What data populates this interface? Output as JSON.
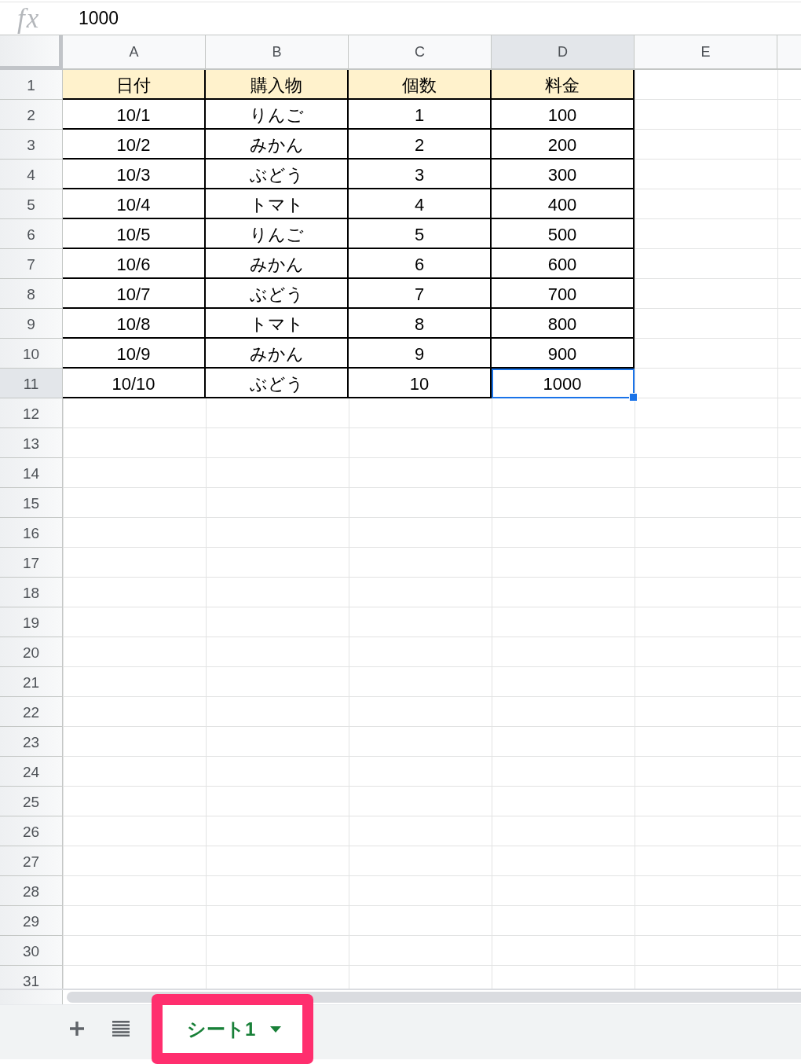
{
  "formula_bar": {
    "label": "fx",
    "value": "1000"
  },
  "columns": [
    {
      "label": "A",
      "selected": false
    },
    {
      "label": "B",
      "selected": false
    },
    {
      "label": "C",
      "selected": false
    },
    {
      "label": "D",
      "selected": true
    },
    {
      "label": "E",
      "selected": false
    }
  ],
  "rows": [
    {
      "label": "1",
      "kind": "header",
      "selected": false,
      "cells": [
        "日付",
        "購入物",
        "個数",
        "料金"
      ]
    },
    {
      "label": "2",
      "kind": "data",
      "selected": false,
      "cells": [
        "10/1",
        "りんご",
        "1",
        "100"
      ]
    },
    {
      "label": "3",
      "kind": "data",
      "selected": false,
      "cells": [
        "10/2",
        "みかん",
        "2",
        "200"
      ]
    },
    {
      "label": "4",
      "kind": "data",
      "selected": false,
      "cells": [
        "10/3",
        "ぶどう",
        "3",
        "300"
      ]
    },
    {
      "label": "5",
      "kind": "data",
      "selected": false,
      "cells": [
        "10/4",
        "トマト",
        "4",
        "400"
      ]
    },
    {
      "label": "6",
      "kind": "data",
      "selected": false,
      "cells": [
        "10/5",
        "りんご",
        "5",
        "500"
      ]
    },
    {
      "label": "7",
      "kind": "data",
      "selected": false,
      "cells": [
        "10/6",
        "みかん",
        "6",
        "600"
      ]
    },
    {
      "label": "8",
      "kind": "data",
      "selected": false,
      "cells": [
        "10/7",
        "ぶどう",
        "7",
        "700"
      ]
    },
    {
      "label": "9",
      "kind": "data",
      "selected": false,
      "cells": [
        "10/8",
        "トマト",
        "8",
        "800"
      ]
    },
    {
      "label": "10",
      "kind": "data",
      "selected": false,
      "cells": [
        "10/9",
        "みかん",
        "9",
        "900"
      ]
    },
    {
      "label": "11",
      "kind": "data",
      "selected": true,
      "cells": [
        "10/10",
        "ぶどう",
        "10",
        "1000"
      ]
    },
    {
      "label": "12",
      "kind": "empty",
      "selected": false
    },
    {
      "label": "13",
      "kind": "empty",
      "selected": false
    },
    {
      "label": "14",
      "kind": "empty",
      "selected": false
    },
    {
      "label": "15",
      "kind": "empty",
      "selected": false
    },
    {
      "label": "16",
      "kind": "empty",
      "selected": false
    },
    {
      "label": "17",
      "kind": "empty",
      "selected": false
    },
    {
      "label": "18",
      "kind": "empty",
      "selected": false
    },
    {
      "label": "19",
      "kind": "empty",
      "selected": false
    },
    {
      "label": "20",
      "kind": "empty",
      "selected": false
    },
    {
      "label": "21",
      "kind": "empty",
      "selected": false
    },
    {
      "label": "22",
      "kind": "empty",
      "selected": false
    },
    {
      "label": "23",
      "kind": "empty",
      "selected": false
    },
    {
      "label": "24",
      "kind": "empty",
      "selected": false
    },
    {
      "label": "25",
      "kind": "empty",
      "selected": false
    },
    {
      "label": "26",
      "kind": "empty",
      "selected": false
    },
    {
      "label": "27",
      "kind": "empty",
      "selected": false
    },
    {
      "label": "28",
      "kind": "empty",
      "selected": false
    },
    {
      "label": "29",
      "kind": "empty",
      "selected": false
    },
    {
      "label": "30",
      "kind": "empty",
      "selected": false
    },
    {
      "label": "31",
      "kind": "empty",
      "selected": false
    }
  ],
  "sheet_tabs": [
    {
      "label": "シート1",
      "selected": true,
      "highlighted": true
    }
  ]
}
